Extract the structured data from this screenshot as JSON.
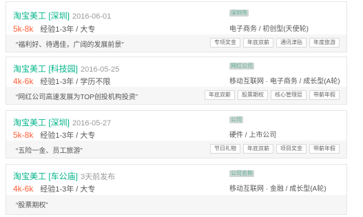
{
  "jobs": [
    {
      "title": "淘宝美工 [深圳]",
      "date": "2016-06-01",
      "salary": "5k-8k",
      "requirements": "经验1-3年 / 大专",
      "company_name": "深圳市",
      "industry": "电子商务 / 初创型(天使轮)",
      "advantage": "“福利好、待遇佳，广阔的发展前景”",
      "tags": [
        "专项奖金",
        "年底双薪",
        "通讯津贴",
        "年度旅游"
      ]
    },
    {
      "title": "淘宝美工 [科技园]",
      "date": "2016-05-25",
      "salary": "4k-6k",
      "requirements": "经验1-3年 / 学历不限",
      "company_name": "网红公司",
      "industry": "移动互联网 · 电子商务 / 成长型(A轮)",
      "advantage": "“网红公司高速发展为TOP创投机构投资”",
      "tags": [
        "年底双薪",
        "股票期权",
        "核心管理层",
        "带薪年假"
      ]
    },
    {
      "title": "淘宝美工 [深圳]",
      "date": "2016-05-27",
      "salary": "5k-8k",
      "requirements": "经验1-3年 / 大专",
      "company_name": "公司",
      "industry": "硬件 / 上市公司",
      "advantage": "“五险一金、员工旅游”",
      "tags": [
        "节日礼物",
        "年底双薪",
        "项目奖金",
        "带薪年假"
      ]
    },
    {
      "title": "淘宝美工 [车公庙]",
      "date": "3天前发布",
      "salary": "4k-6k",
      "requirements": "经验1-3年 / 大专",
      "company_name": "公司名称",
      "industry": "移动互联网 · 金融 / 成长型(A轮)",
      "advantage": "“股票期权”",
      "tags": []
    }
  ],
  "colors": {
    "title": "#00b38a",
    "salary": "#fd5f39",
    "secondary": "#999999",
    "bottom_bar": "#f6f6f6"
  }
}
